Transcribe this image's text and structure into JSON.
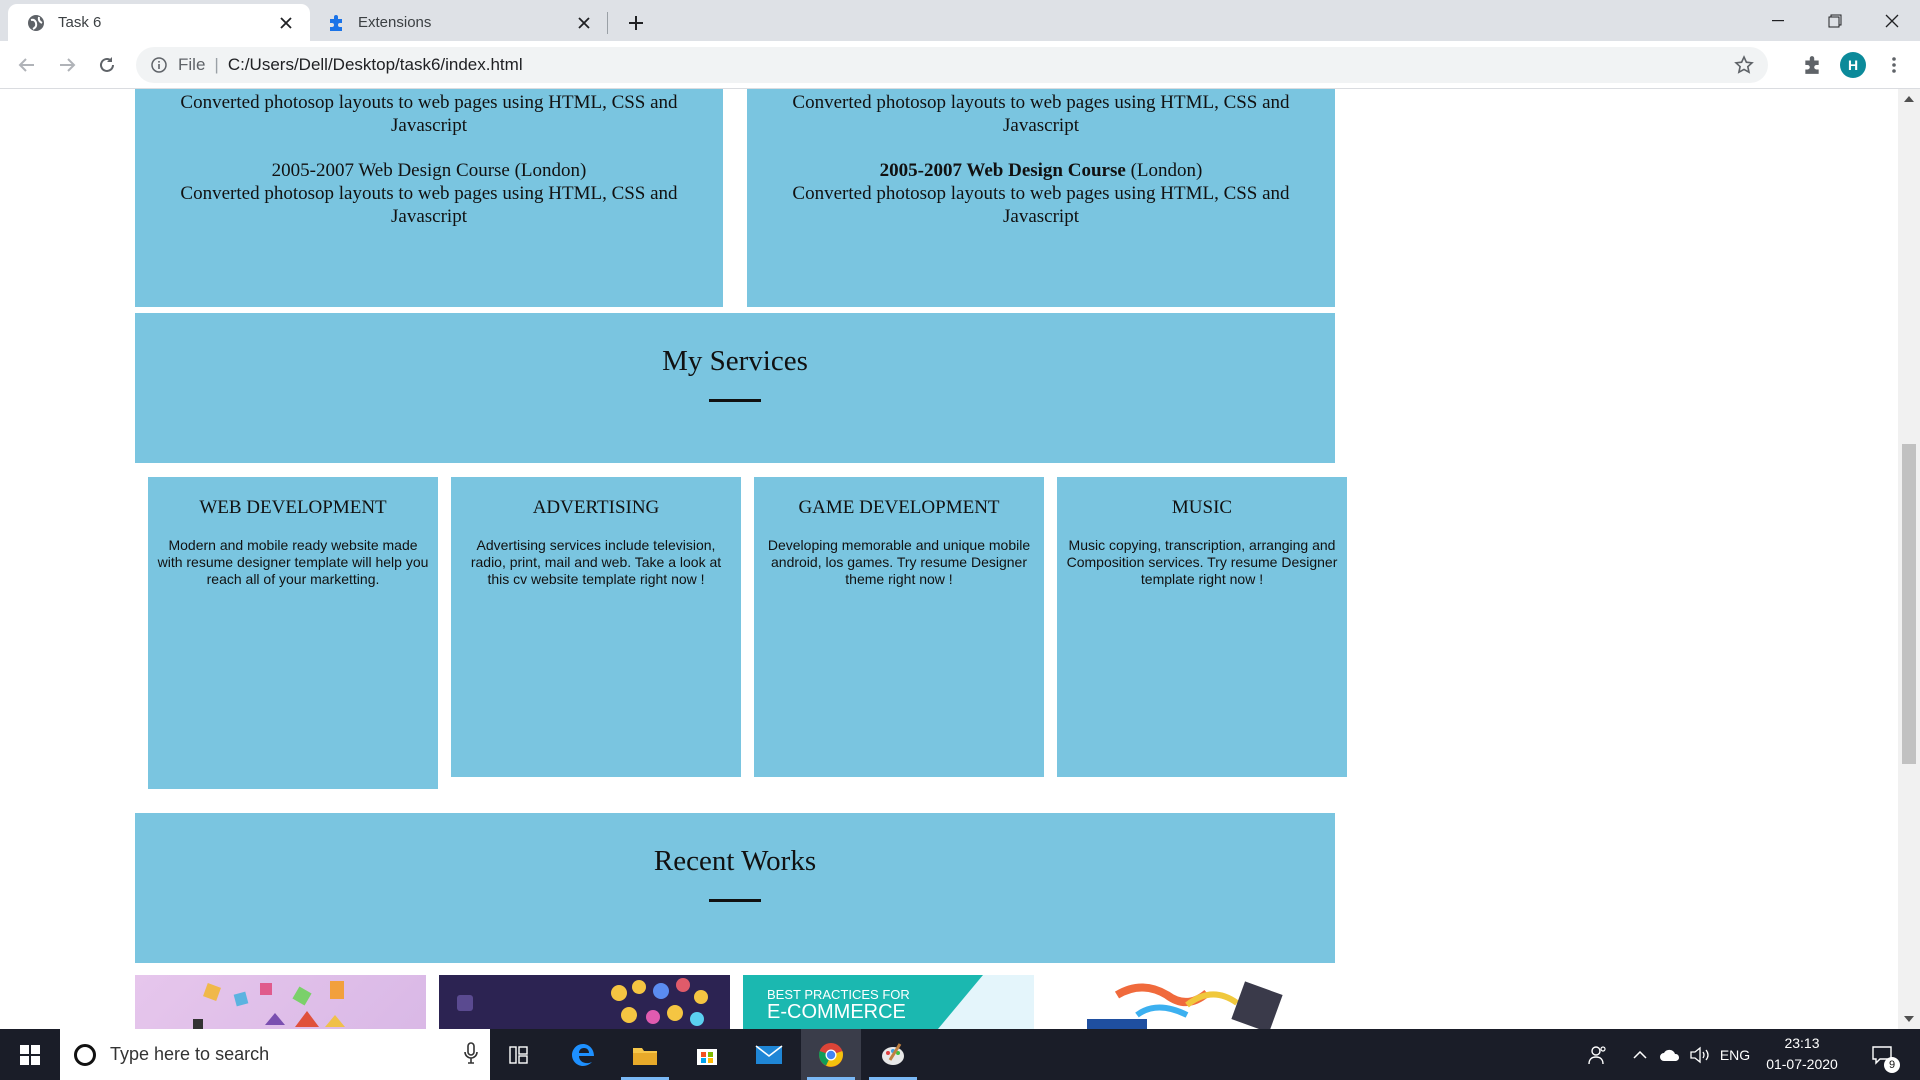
{
  "browser": {
    "tabs": [
      {
        "title": "Task 6",
        "active": true
      },
      {
        "title": "Extensions",
        "active": false
      }
    ],
    "address": {
      "scheme_label": "File",
      "url": "C:/Users/Dell/Desktop/task6/index.html"
    },
    "profile_initial": "H"
  },
  "experience": {
    "left": [
      {
        "text": "Converted photosop layouts to web pages using HTML, CSS and Javascript"
      },
      {
        "title": "2005-2007 Web Design Course",
        "location": "(London)",
        "text": "Converted photosop layouts to web pages using HTML, CSS and Javascript"
      }
    ],
    "right": [
      {
        "text": "Converted photosop layouts to web pages using HTML, CSS and Javascript"
      },
      {
        "title": "2005-2007 Web Design Course",
        "location": "(London)",
        "text": "Converted photosop layouts to web pages using HTML, CSS and Javascript"
      }
    ]
  },
  "services": {
    "heading": "My Services",
    "items": [
      {
        "title": "WEB DEVELOPMENT",
        "text": "Modern and mobile ready website made with resume designer template will help you reach all of your marketting."
      },
      {
        "title": "ADVERTISING",
        "text": "Advertising services include television, radio, print, mail and web. Take a look at this cv website template right now !"
      },
      {
        "title": "GAME DEVELOPMENT",
        "text": "Developing memorable and unique mobile android, los games. Try resume Designer theme right now !"
      },
      {
        "title": "MUSIC",
        "text": "Music copying, transcription, arranging and Composition services. Try resume Designer template right now !"
      }
    ]
  },
  "recent_works": {
    "heading": "Recent Works",
    "thumb3_line1": "BEST PRACTICES FOR",
    "thumb3_line2": "E-COMMERCE"
  },
  "taskbar": {
    "search_placeholder": "Type here to search",
    "language": "ENG",
    "time": "23:13",
    "date": "01-07-2020",
    "notification_count": "9"
  },
  "colors": {
    "section_blue": "#7ac5e0",
    "taskbar": "#1a1d28",
    "tabstrip": "#dee1e6"
  }
}
